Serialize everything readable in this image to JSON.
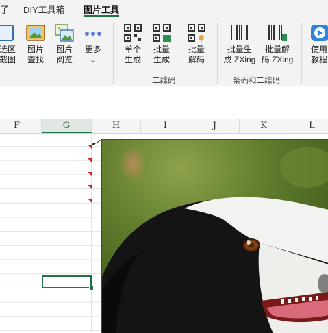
{
  "tabs": [
    {
      "label": "子",
      "active": false
    },
    {
      "label": "DIY工具箱",
      "active": false
    },
    {
      "label": "图片工具",
      "active": true
    }
  ],
  "ribbon": {
    "buttons": [
      {
        "label": "选区\n截图",
        "icon": "screenshot-icon"
      },
      {
        "label": "图片\n查找",
        "icon": "image-search-icon"
      },
      {
        "label": "图片\n阅览",
        "icon": "image-gallery-icon"
      },
      {
        "label": "更多",
        "icon": "more-dots-icon",
        "caret": "⌄"
      },
      {
        "label": "单个\n生成",
        "icon": "qr-code-icon"
      },
      {
        "label": "批量\n生成",
        "icon": "qr-batch-icon"
      },
      {
        "label": "批量\n解码",
        "icon": "qr-decode-icon"
      },
      {
        "label": "批量生\n成 ZXing",
        "icon": "barcode-icon"
      },
      {
        "label": "批量解\n码 ZXing",
        "icon": "barcode-decode-icon"
      },
      {
        "label": "使用\n教程",
        "icon": "play-tutorial-icon"
      }
    ],
    "groups": [
      "二维码",
      "条码和二维码"
    ]
  },
  "sheet": {
    "columns": [
      "F",
      "G",
      "H",
      "I",
      "J",
      "K",
      "L"
    ],
    "selected_column": "G"
  },
  "colors": {
    "accent": "#217346",
    "comment_marker": "#d42020"
  }
}
